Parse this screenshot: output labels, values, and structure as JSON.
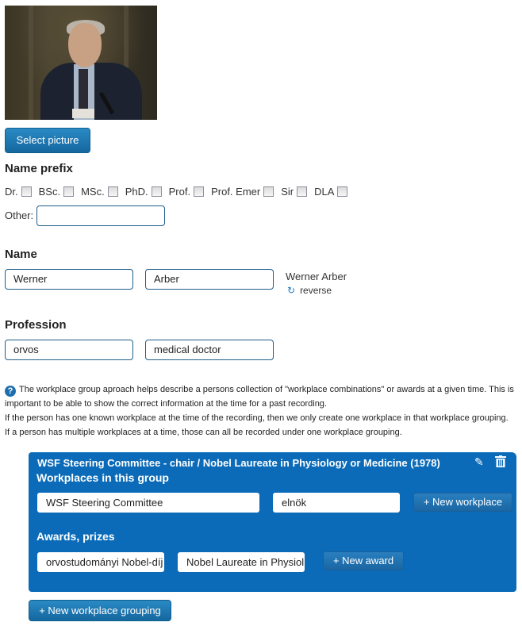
{
  "picture": {
    "alt": "Portrait photo of a grey-haired man in a dark suit speaking at a microphone",
    "select_label": "Select picture"
  },
  "name_prefix": {
    "heading": "Name prefix",
    "options": [
      {
        "label": "Dr.",
        "checked": false
      },
      {
        "label": "BSc.",
        "checked": false
      },
      {
        "label": "MSc.",
        "checked": false
      },
      {
        "label": "PhD.",
        "checked": false
      },
      {
        "label": "Prof.",
        "checked": false
      },
      {
        "label": "Prof. Emer",
        "checked": false
      },
      {
        "label": "Sir",
        "checked": false
      },
      {
        "label": "DLA",
        "checked": false
      }
    ],
    "other_label": "Other:",
    "other_value": ""
  },
  "name": {
    "heading": "Name",
    "first_value": "Werner",
    "last_value": "Arber",
    "preview": "Werner Arber",
    "reverse_label": "reverse",
    "reverse_icon": "refresh-icon"
  },
  "profession": {
    "heading": "Profession",
    "value_hu": "orvos",
    "value_en": "medical doctor"
  },
  "info": {
    "icon": "question-icon",
    "line1": "The workplace group aproach helps describe a persons collection of \"workplace combinations\" or awards at a given time. This is important to be able to show the correct information at the time for a past recording.",
    "line2": "If the person has one known workplace at the time of the recording, then we only create one workplace in that workplace grouping.",
    "line3": "If a person has multiple workplaces at a time, those can all be recorded under one workplace grouping."
  },
  "workplace_group": {
    "title": "WSF Steering Committee - chair / Nobel Laureate in Physiology or Medicine (1978)",
    "edit_icon": "pencil-icon",
    "delete_icon": "trash-icon",
    "workplaces_heading": "Workplaces in this group",
    "workplace_name": "WSF Steering Committee",
    "workplace_role": "elnök",
    "new_workplace_label": "+ New workplace",
    "awards_heading": "Awards, prizes",
    "award_hu": "orvostudományi Nobel-díj",
    "award_en": "Nobel Laureate in Physiology or Medicine",
    "new_award_label": "+ New award"
  },
  "new_grouping_label": "+ New workplace grouping",
  "colors": {
    "accent": "#0b6bb8",
    "button": "#1f78b4",
    "input_border": "#1f5d8a"
  }
}
